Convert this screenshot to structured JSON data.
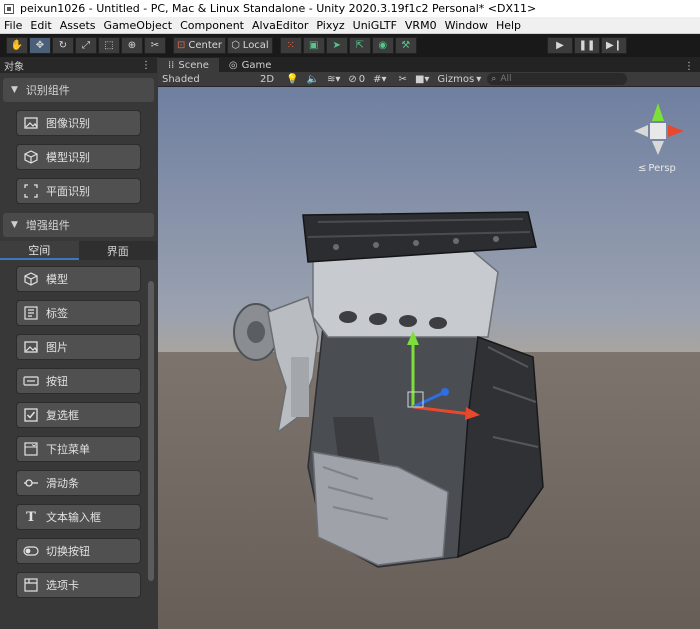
{
  "window": {
    "title": "peixun1026 - Untitled - PC, Mac & Linux Standalone - Unity 2020.3.19f1c2 Personal* <DX11>"
  },
  "menu": [
    "File",
    "Edit",
    "Assets",
    "GameObject",
    "Component",
    "AlvaEditor",
    "Pixyz",
    "UniGLTF",
    "VRM0",
    "Window",
    "Help"
  ],
  "toolbar": {
    "pivot_label": "Center",
    "space_label": "Local"
  },
  "left_panel": {
    "title": "对象",
    "section1": "识别组件",
    "recog_items": [
      "图像识别",
      "模型识别",
      "平面识别"
    ],
    "section2": "增强组件",
    "tabs": [
      "空间",
      "界面"
    ],
    "enhance_items": [
      "模型",
      "标签",
      "图片",
      "按钮",
      "复选框",
      "下拉菜单",
      "滑动条",
      "文本输入框",
      "切换按钮",
      "选项卡"
    ]
  },
  "scene": {
    "tabs": [
      "Scene",
      "Game"
    ],
    "shading_mode": "Shaded",
    "mode_2d": "2D",
    "hidden_count": "0",
    "gizmos_label": "Gizmos",
    "search_placeholder": "All",
    "persp_label": "Persp"
  },
  "colors": {
    "accent": "#3a79bb",
    "gizmo_y": "#7ddf3a",
    "gizmo_x": "#e8482c",
    "gizmo_z": "#2f6ee0"
  }
}
